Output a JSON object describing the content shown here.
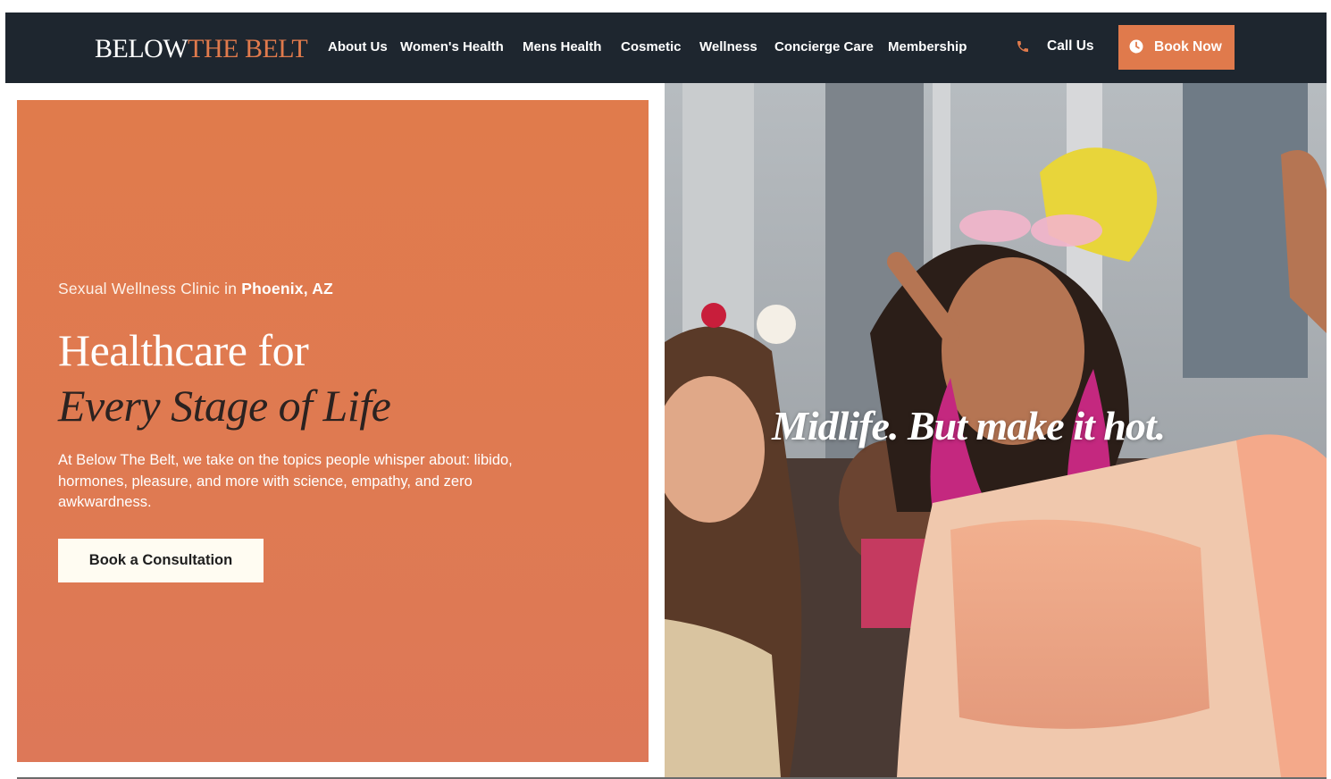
{
  "header": {
    "logo_part1": "BELOW",
    "logo_part2": "THE BELT",
    "nav": [
      {
        "label": "About Us"
      },
      {
        "label": "Women's Health"
      },
      {
        "label": "Mens Health"
      },
      {
        "label": "Cosmetic"
      },
      {
        "label": "Wellness"
      },
      {
        "label": "Concierge Care"
      },
      {
        "label": "Membership"
      }
    ],
    "call_label": "Call Us",
    "book_label": "Book Now",
    "phone_icon": "phone-icon",
    "book_icon": "clock-icon"
  },
  "hero": {
    "eyebrow_prefix": "Sexual Wellness Clinic in ",
    "eyebrow_location": "Phoenix, AZ",
    "headline_line1": "Healthcare for",
    "headline_line2": "Every Stage of Life",
    "description": "At Below The Belt, we take on the topics people whisper about: libido, hormones, pleasure, and more with science, empathy, and zero awkwardness.",
    "cta_label": "Book a Consultation",
    "image_tagline": "Midlife. But make it hot."
  },
  "colors": {
    "header_bg": "#1e262f",
    "accent": "#e07a4c",
    "hero_bg": "#df7a50",
    "cta_bg": "#fffcf2"
  }
}
